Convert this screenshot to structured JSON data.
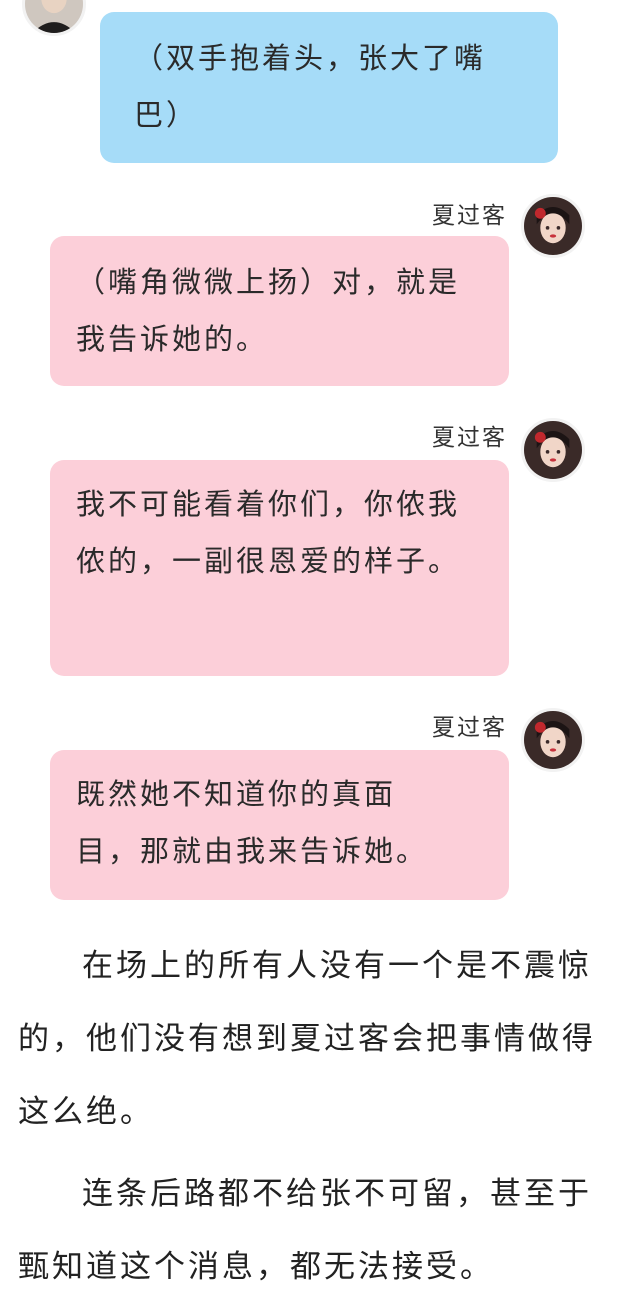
{
  "messages": [
    {
      "text": "（双手抱着头，张大了嘴巴）"
    },
    {
      "name": "夏过客",
      "text": "（嘴角微微上扬）对，就是我告诉她的。"
    },
    {
      "name": "夏过客",
      "text": "我不可能看着你们，你侬我侬的，一副很恩爱的样子。"
    },
    {
      "name": "夏过客",
      "text": "既然她不知道你的真面目，那就由我来告诉她。"
    }
  ],
  "paragraphs": [
    "在场上的所有人没有一个是不震惊的，他们没有想到夏过客会把事情做得这么绝。",
    "连条后路都不给张不可留，甚至于甄知道这个消息，都无法接受。"
  ],
  "icons": {
    "avatar_male": "male-avatar-icon",
    "avatar_female": "female-avatar-icon"
  },
  "colors": {
    "blue_bubble": "#a6dcf8",
    "pink_bubble": "#fccfd9"
  }
}
